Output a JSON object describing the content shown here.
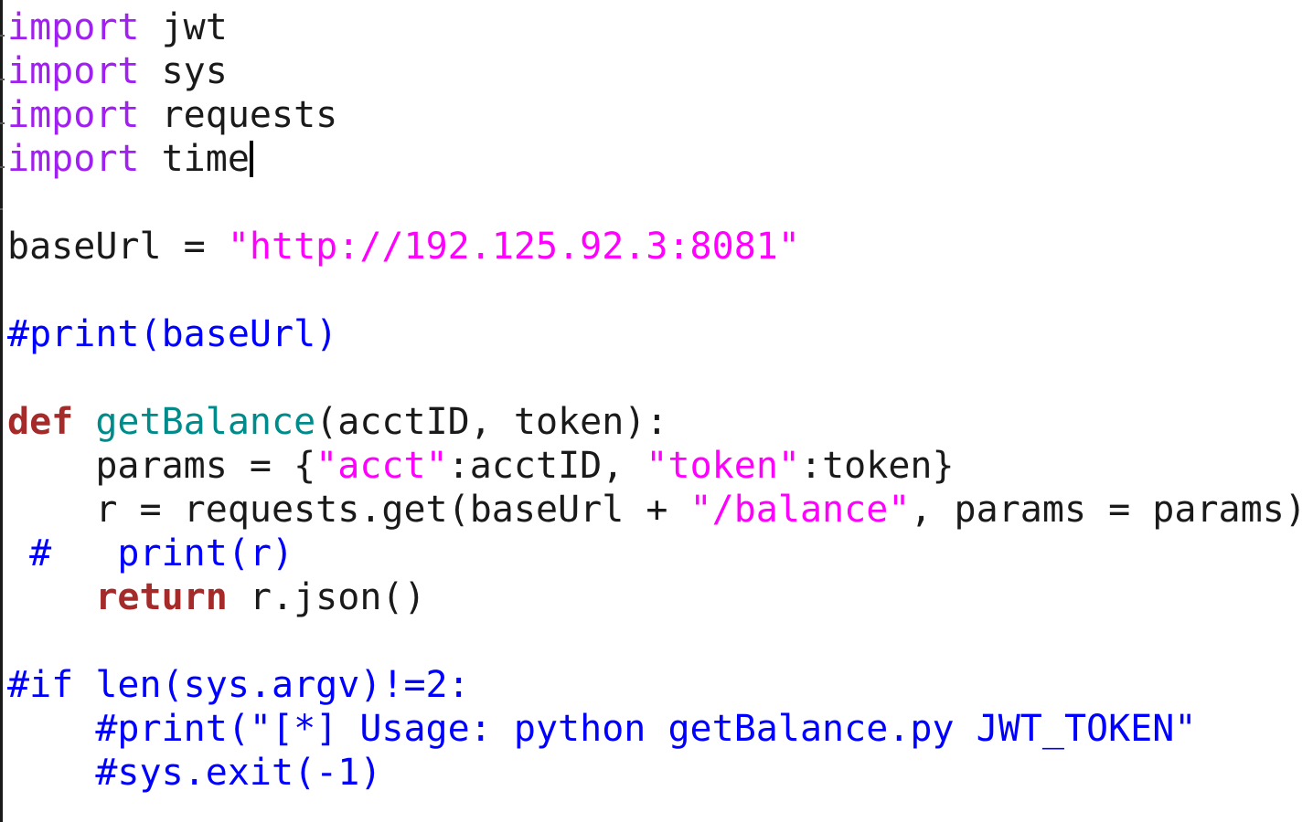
{
  "colors": {
    "default": "#1a1a1a",
    "keyword_import": "#a020f0",
    "string": "#ff00ff",
    "comment": "#0000ff",
    "keyword_def": "#a52a2a",
    "function_name": "#008b8b",
    "cursor": "#000000"
  },
  "editor": {
    "language": "python",
    "cursor_line": 4,
    "lines": [
      [
        {
          "t": "import",
          "c": "keyword_import"
        },
        {
          "t": " jwt",
          "c": "default"
        }
      ],
      [
        {
          "t": "import",
          "c": "keyword_import"
        },
        {
          "t": " sys",
          "c": "default"
        }
      ],
      [
        {
          "t": "import",
          "c": "keyword_import"
        },
        {
          "t": " requests",
          "c": "default"
        }
      ],
      [
        {
          "t": "import",
          "c": "keyword_import"
        },
        {
          "t": " time",
          "c": "default"
        },
        {
          "cursor": true
        }
      ],
      [],
      [
        {
          "t": "baseUrl = ",
          "c": "default"
        },
        {
          "t": "\"http://192.125.92.3:8081\"",
          "c": "string"
        }
      ],
      [],
      [
        {
          "t": "#print(baseUrl)",
          "c": "comment"
        }
      ],
      [],
      [
        {
          "t": "def",
          "c": "keyword_def"
        },
        {
          "t": " ",
          "c": "default"
        },
        {
          "t": "getBalance",
          "c": "function_name"
        },
        {
          "t": "(acctID, token):",
          "c": "default"
        }
      ],
      [
        {
          "t": "    params = {",
          "c": "default"
        },
        {
          "t": "\"acct\"",
          "c": "string"
        },
        {
          "t": ":acctID, ",
          "c": "default"
        },
        {
          "t": "\"token\"",
          "c": "string"
        },
        {
          "t": ":token}",
          "c": "default"
        }
      ],
      [
        {
          "t": "    r = requests.get(baseUrl + ",
          "c": "default"
        },
        {
          "t": "\"/balance\"",
          "c": "string"
        },
        {
          "t": ", params = params)",
          "c": "default"
        }
      ],
      [
        {
          "t": " #   print(r)",
          "c": "comment"
        }
      ],
      [
        {
          "t": "    ",
          "c": "default"
        },
        {
          "t": "return",
          "c": "keyword_def"
        },
        {
          "t": " r.json()",
          "c": "default"
        }
      ],
      [],
      [
        {
          "t": "#if len(sys.argv)!=2:",
          "c": "comment"
        }
      ],
      [
        {
          "t": "    #print(\"[*] Usage: python getBalance.py JWT_TOKEN\"",
          "c": "comment"
        }
      ],
      [
        {
          "t": "    #sys.exit(-1)",
          "c": "comment"
        }
      ]
    ]
  }
}
